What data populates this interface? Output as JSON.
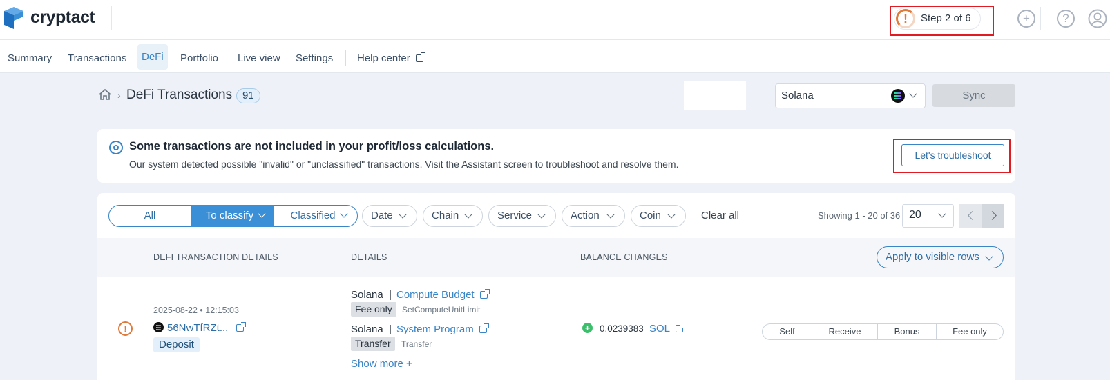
{
  "brand": {
    "name": "cryptact"
  },
  "header": {
    "step_text": "Step 2 of 6",
    "step_mark": "!",
    "add_glyph": "+",
    "help_glyph": "?"
  },
  "nav": {
    "items": [
      "Summary",
      "Transactions",
      "DeFi",
      "Portfolio",
      "Live view",
      "Settings",
      "Help center"
    ],
    "active": "DeFi"
  },
  "page": {
    "title": "DeFi Transactions",
    "count": "91",
    "breadcrumb_sep": "›",
    "chain_select": "Solana",
    "sync_label": "Sync"
  },
  "alert": {
    "title": "Some transactions are not included in your profit/loss calculations.",
    "body": "Our system detected possible \"invalid\" or \"unclassified\" transactions. Visit the Assistant screen to troubleshoot and resolve them.",
    "button": "Let's troubleshoot"
  },
  "filters": {
    "segments": [
      "All",
      "To classify",
      "Classified"
    ],
    "active_segment": "To classify",
    "pills": [
      "Date",
      "Chain",
      "Service",
      "Action",
      "Coin"
    ],
    "clear_all": "Clear all",
    "showing": "Showing 1 - 20 of 36",
    "per_page": "20"
  },
  "table": {
    "headers": [
      "DEFI TRANSACTION DETAILS",
      "DETAILS",
      "BALANCE CHANGES"
    ],
    "apply_label": "Apply to visible rows",
    "rows": [
      {
        "status_icon": "!",
        "date": "2025-08-22 • 12:15:03",
        "hash": "56NwTfRZt...",
        "type": "Deposit",
        "details": [
          {
            "chain": "Solana",
            "sep": "|",
            "program": "Compute Budget",
            "tag": "Fee only",
            "method": "SetComputeUnitLimit"
          },
          {
            "chain": "Solana",
            "sep": "|",
            "program": "System Program",
            "tag": "Transfer",
            "method": "Transfer"
          }
        ],
        "show_more": "Show more +",
        "balance": {
          "sign": "+",
          "amount": "0.0239383",
          "coin": "SOL"
        },
        "actions": [
          "Self",
          "Receive",
          "Bonus",
          "Fee only"
        ]
      }
    ]
  },
  "colors": {
    "accent": "#3a85c5",
    "highlight": "#e01c22",
    "warning": "#e07a3a",
    "positive": "#3bbf6b"
  }
}
